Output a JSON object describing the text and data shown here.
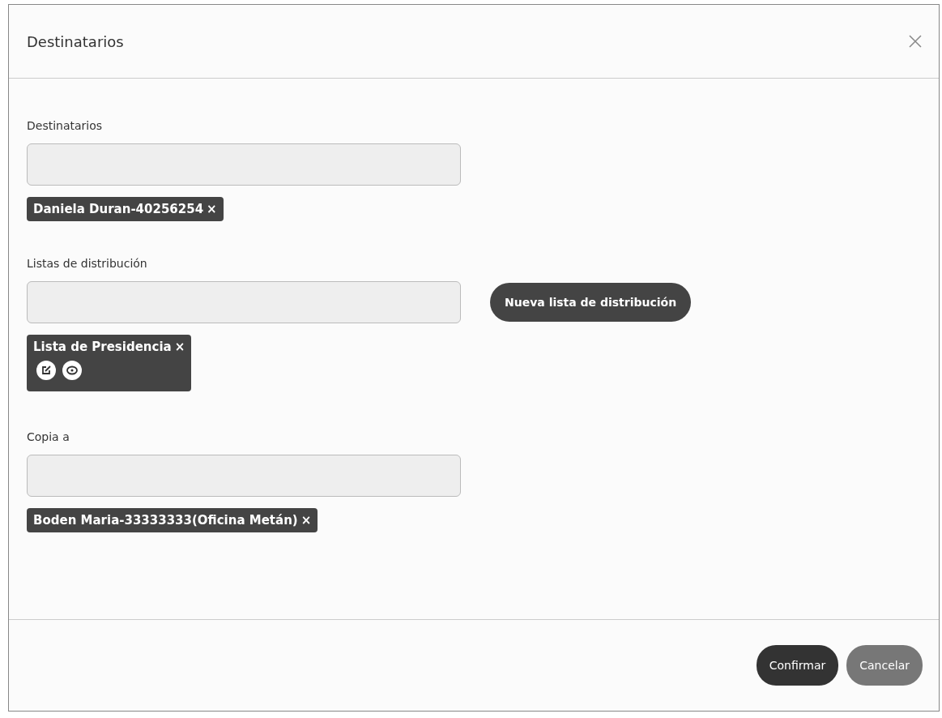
{
  "dialog": {
    "title": "Destinatarios"
  },
  "sections": [
    {
      "label": "Destinatarios",
      "chips": [
        {
          "text": "Daniela Duran-40256254",
          "remove": "×",
          "actions": false
        }
      ]
    },
    {
      "label": "Listas de distribución",
      "button": "Nueva lista de distribución",
      "chips": [
        {
          "text": "Lista de Presidencia",
          "remove": "×",
          "actions": true
        }
      ]
    },
    {
      "label": "Copia a",
      "chips": [
        {
          "text": "Boden Maria-33333333(Oficina Metán)",
          "remove": "×",
          "actions": false
        }
      ]
    }
  ],
  "buttons": [
    {
      "label": "Confirmar",
      "kind": "primary"
    },
    {
      "label": "Cancelar",
      "kind": "secondary"
    }
  ]
}
